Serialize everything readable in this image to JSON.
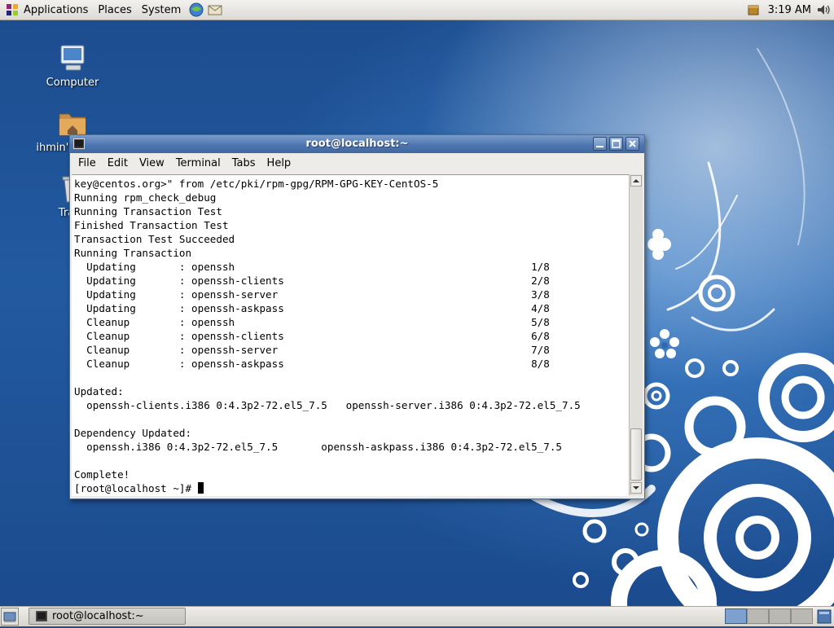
{
  "top_panel": {
    "menus": [
      "Applications",
      "Places",
      "System"
    ],
    "clock": "3:19 AM"
  },
  "desktop": {
    "icons": [
      {
        "label": "Computer"
      },
      {
        "label": "ihmin's Home"
      },
      {
        "label": "Trash"
      }
    ]
  },
  "terminal": {
    "title": "root@localhost:~",
    "menu": [
      "File",
      "Edit",
      "View",
      "Terminal",
      "Tabs",
      "Help"
    ],
    "lines": [
      "key@centos.org>\" from /etc/pki/rpm-gpg/RPM-GPG-KEY-CentOS-5",
      "Running rpm_check_debug",
      "Running Transaction Test",
      "Finished Transaction Test",
      "Transaction Test Succeeded",
      "Running Transaction",
      "  Updating       : openssh                                                1/8",
      "  Updating       : openssh-clients                                        2/8",
      "  Updating       : openssh-server                                         3/8",
      "  Updating       : openssh-askpass                                        4/8",
      "  Cleanup        : openssh                                                5/8",
      "  Cleanup        : openssh-clients                                        6/8",
      "  Cleanup        : openssh-server                                         7/8",
      "  Cleanup        : openssh-askpass                                        8/8",
      "",
      "Updated:",
      "  openssh-clients.i386 0:4.3p2-72.el5_7.5   openssh-server.i386 0:4.3p2-72.el5_7.5",
      "",
      "Dependency Updated:",
      "  openssh.i386 0:4.3p2-72.el5_7.5       openssh-askpass.i386 0:4.3p2-72.el5_7.5",
      "",
      "Complete!",
      "[root@localhost ~]# "
    ],
    "scroll_position": 0.96
  },
  "bottom_panel": {
    "task_label": "root@localhost:~",
    "workspaces": 4,
    "active_workspace": 1
  },
  "colors": {
    "titlebar": "#4d76b1",
    "desktop": "#1d4f8f",
    "active_workspace": "#7da0cf"
  }
}
